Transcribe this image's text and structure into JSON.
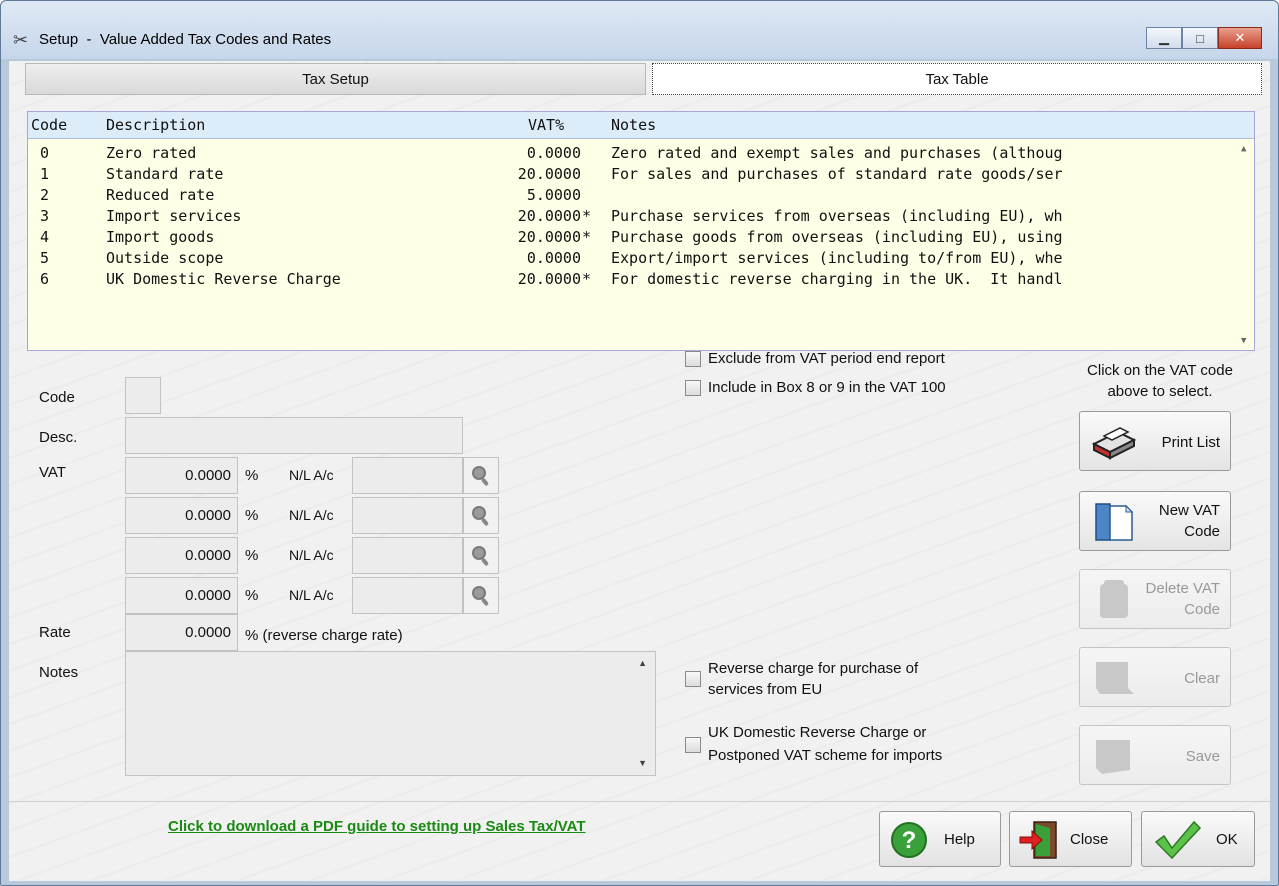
{
  "window": {
    "title": "Setup  -  Value Added Tax Codes and Rates",
    "minimize": "▁",
    "maximize": "□",
    "close": "✕"
  },
  "tabs": [
    {
      "label": "Tax Setup",
      "active": false
    },
    {
      "label": "Tax Table",
      "active": true
    }
  ],
  "table": {
    "columns": [
      "Code",
      "Description",
      "VAT%",
      "Notes"
    ],
    "rows": [
      {
        "code": "0",
        "description": "Zero rated",
        "vat": "0.0000",
        "flag": "",
        "notes": "Zero rated and exempt sales and purchases (althoug"
      },
      {
        "code": "1",
        "description": "Standard rate",
        "vat": "20.0000",
        "flag": "",
        "notes": "For sales and purchases of standard rate goods/ser"
      },
      {
        "code": "2",
        "description": "Reduced rate",
        "vat": "5.0000",
        "flag": "",
        "notes": ""
      },
      {
        "code": "3",
        "description": "Import services",
        "vat": "20.0000",
        "flag": "*",
        "notes": "Purchase services from overseas (including EU), wh"
      },
      {
        "code": "4",
        "description": "Import goods",
        "vat": "20.0000",
        "flag": "*",
        "notes": "Purchase goods from overseas (including EU), using"
      },
      {
        "code": "5",
        "description": "Outside scope",
        "vat": "0.0000",
        "flag": "",
        "notes": "Export/import services (including to/from EU), whe"
      },
      {
        "code": "6",
        "description": "UK Domestic Reverse Charge",
        "vat": "20.0000",
        "flag": "*",
        "notes": "For domestic reverse charging in the UK.  It handl"
      }
    ]
  },
  "form": {
    "code_label": "Code",
    "code_value": "",
    "desc_label": "Desc.",
    "desc_value": "",
    "vat_label": "VAT",
    "vat_rows": [
      {
        "rate": "0.0000",
        "pct": "%",
        "nl_label": "N/L A/c",
        "nl_value": ""
      },
      {
        "rate": "0.0000",
        "pct": "%",
        "nl_label": "N/L A/c",
        "nl_value": ""
      },
      {
        "rate": "0.0000",
        "pct": "%",
        "nl_label": "N/L A/c",
        "nl_value": ""
      },
      {
        "rate": "0.0000",
        "pct": "%",
        "nl_label": "N/L A/c",
        "nl_value": ""
      }
    ],
    "rate_label": "Rate",
    "rate_value": "0.0000",
    "rate_suffix": "% (reverse charge rate)",
    "notes_label": "Notes",
    "notes_value": ""
  },
  "checkboxes": {
    "exclude_vat_period": {
      "label": "Exclude from VAT period end report",
      "checked": false
    },
    "include_box_8_9": {
      "label": "Include in Box 8 or 9 in the VAT 100",
      "checked": false
    },
    "reverse_charge_eu": {
      "line1": "Reverse charge for purchase of",
      "line2": "services from EU",
      "checked": false
    },
    "uk_domestic_reverse": {
      "line1": "UK Domestic Reverse Charge or",
      "line2": "Postponed VAT scheme for imports",
      "checked": false
    }
  },
  "side": {
    "hint_line1": "Click on the VAT code",
    "hint_line2": "above to select.",
    "print_list": "Print List",
    "new_vat_code": "New VAT\nCode",
    "delete_vat_code": "Delete VAT\nCode",
    "clear": "Clear",
    "save": "Save"
  },
  "footer": {
    "pdf_link": "Click to download a PDF guide to setting up Sales Tax/VAT",
    "help": "Help",
    "close": "Close",
    "ok": "OK"
  },
  "colors": {
    "grid_background": "#ffffe8",
    "grid_header": "#dcecf8",
    "link_green": "#1a8a14"
  }
}
